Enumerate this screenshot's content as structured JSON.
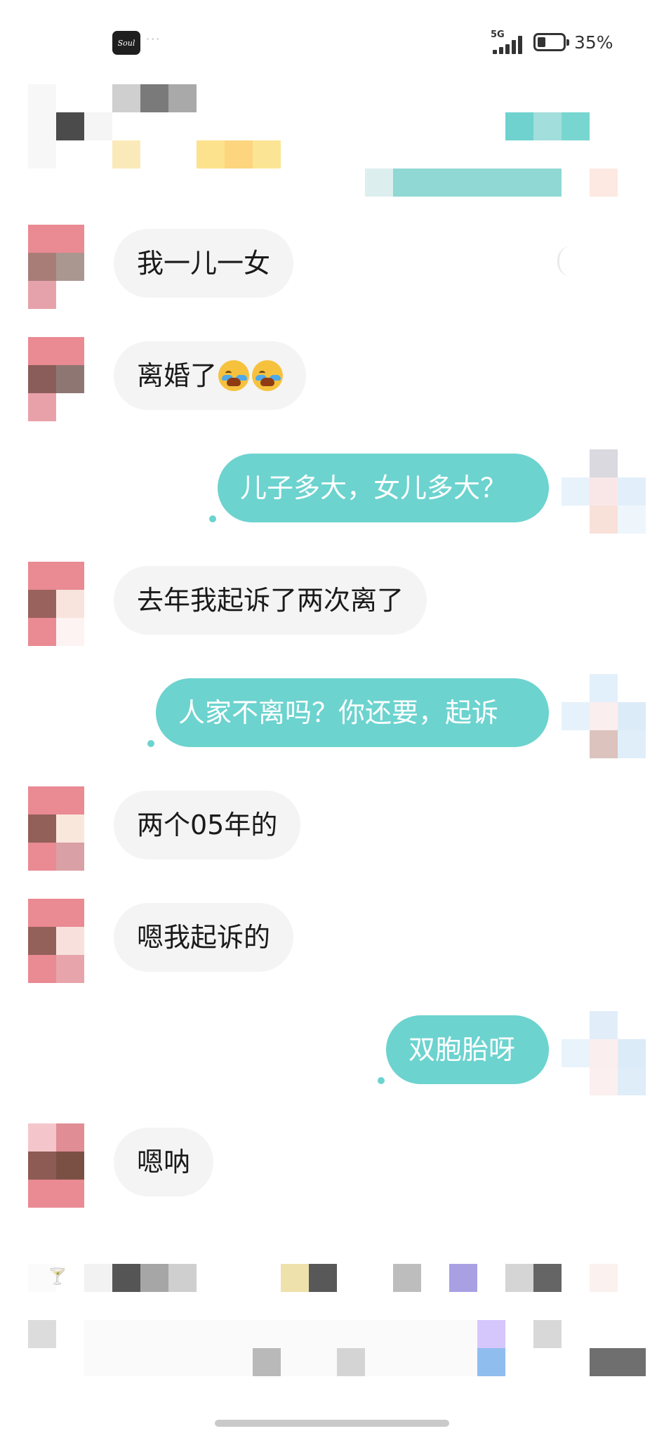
{
  "status_bar": {
    "app_icon": "Soul",
    "notification_dots": "···",
    "network": "5G",
    "battery_percent": "35%",
    "battery_level": 0.35,
    "icons": [
      "signal-icon",
      "battery-icon"
    ]
  },
  "messages": [
    {
      "id": "m1",
      "sender": "other",
      "text": "我一儿一女"
    },
    {
      "id": "m2",
      "sender": "other",
      "text": "离婚了",
      "emojis": [
        "loudly-crying-face",
        "loudly-crying-face"
      ]
    },
    {
      "id": "m3",
      "sender": "self",
      "text": "儿子多大，女儿多大？"
    },
    {
      "id": "m4",
      "sender": "other",
      "text": "去年我起诉了两次离了"
    },
    {
      "id": "m5",
      "sender": "self",
      "text": "人家不离吗？你还要，起诉"
    },
    {
      "id": "m6",
      "sender": "other",
      "text": "两个05年的"
    },
    {
      "id": "m7",
      "sender": "other",
      "text": "嗯我起诉的"
    },
    {
      "id": "m8",
      "sender": "self",
      "text": "双胞胎呀"
    },
    {
      "id": "m9",
      "sender": "other",
      "text": "嗯呐"
    }
  ],
  "colors": {
    "incoming_bubble": "#f4f4f4",
    "outgoing_bubble": "#6cd3cf",
    "outgoing_text": "#ffffff",
    "incoming_text": "#1a1a1a"
  }
}
